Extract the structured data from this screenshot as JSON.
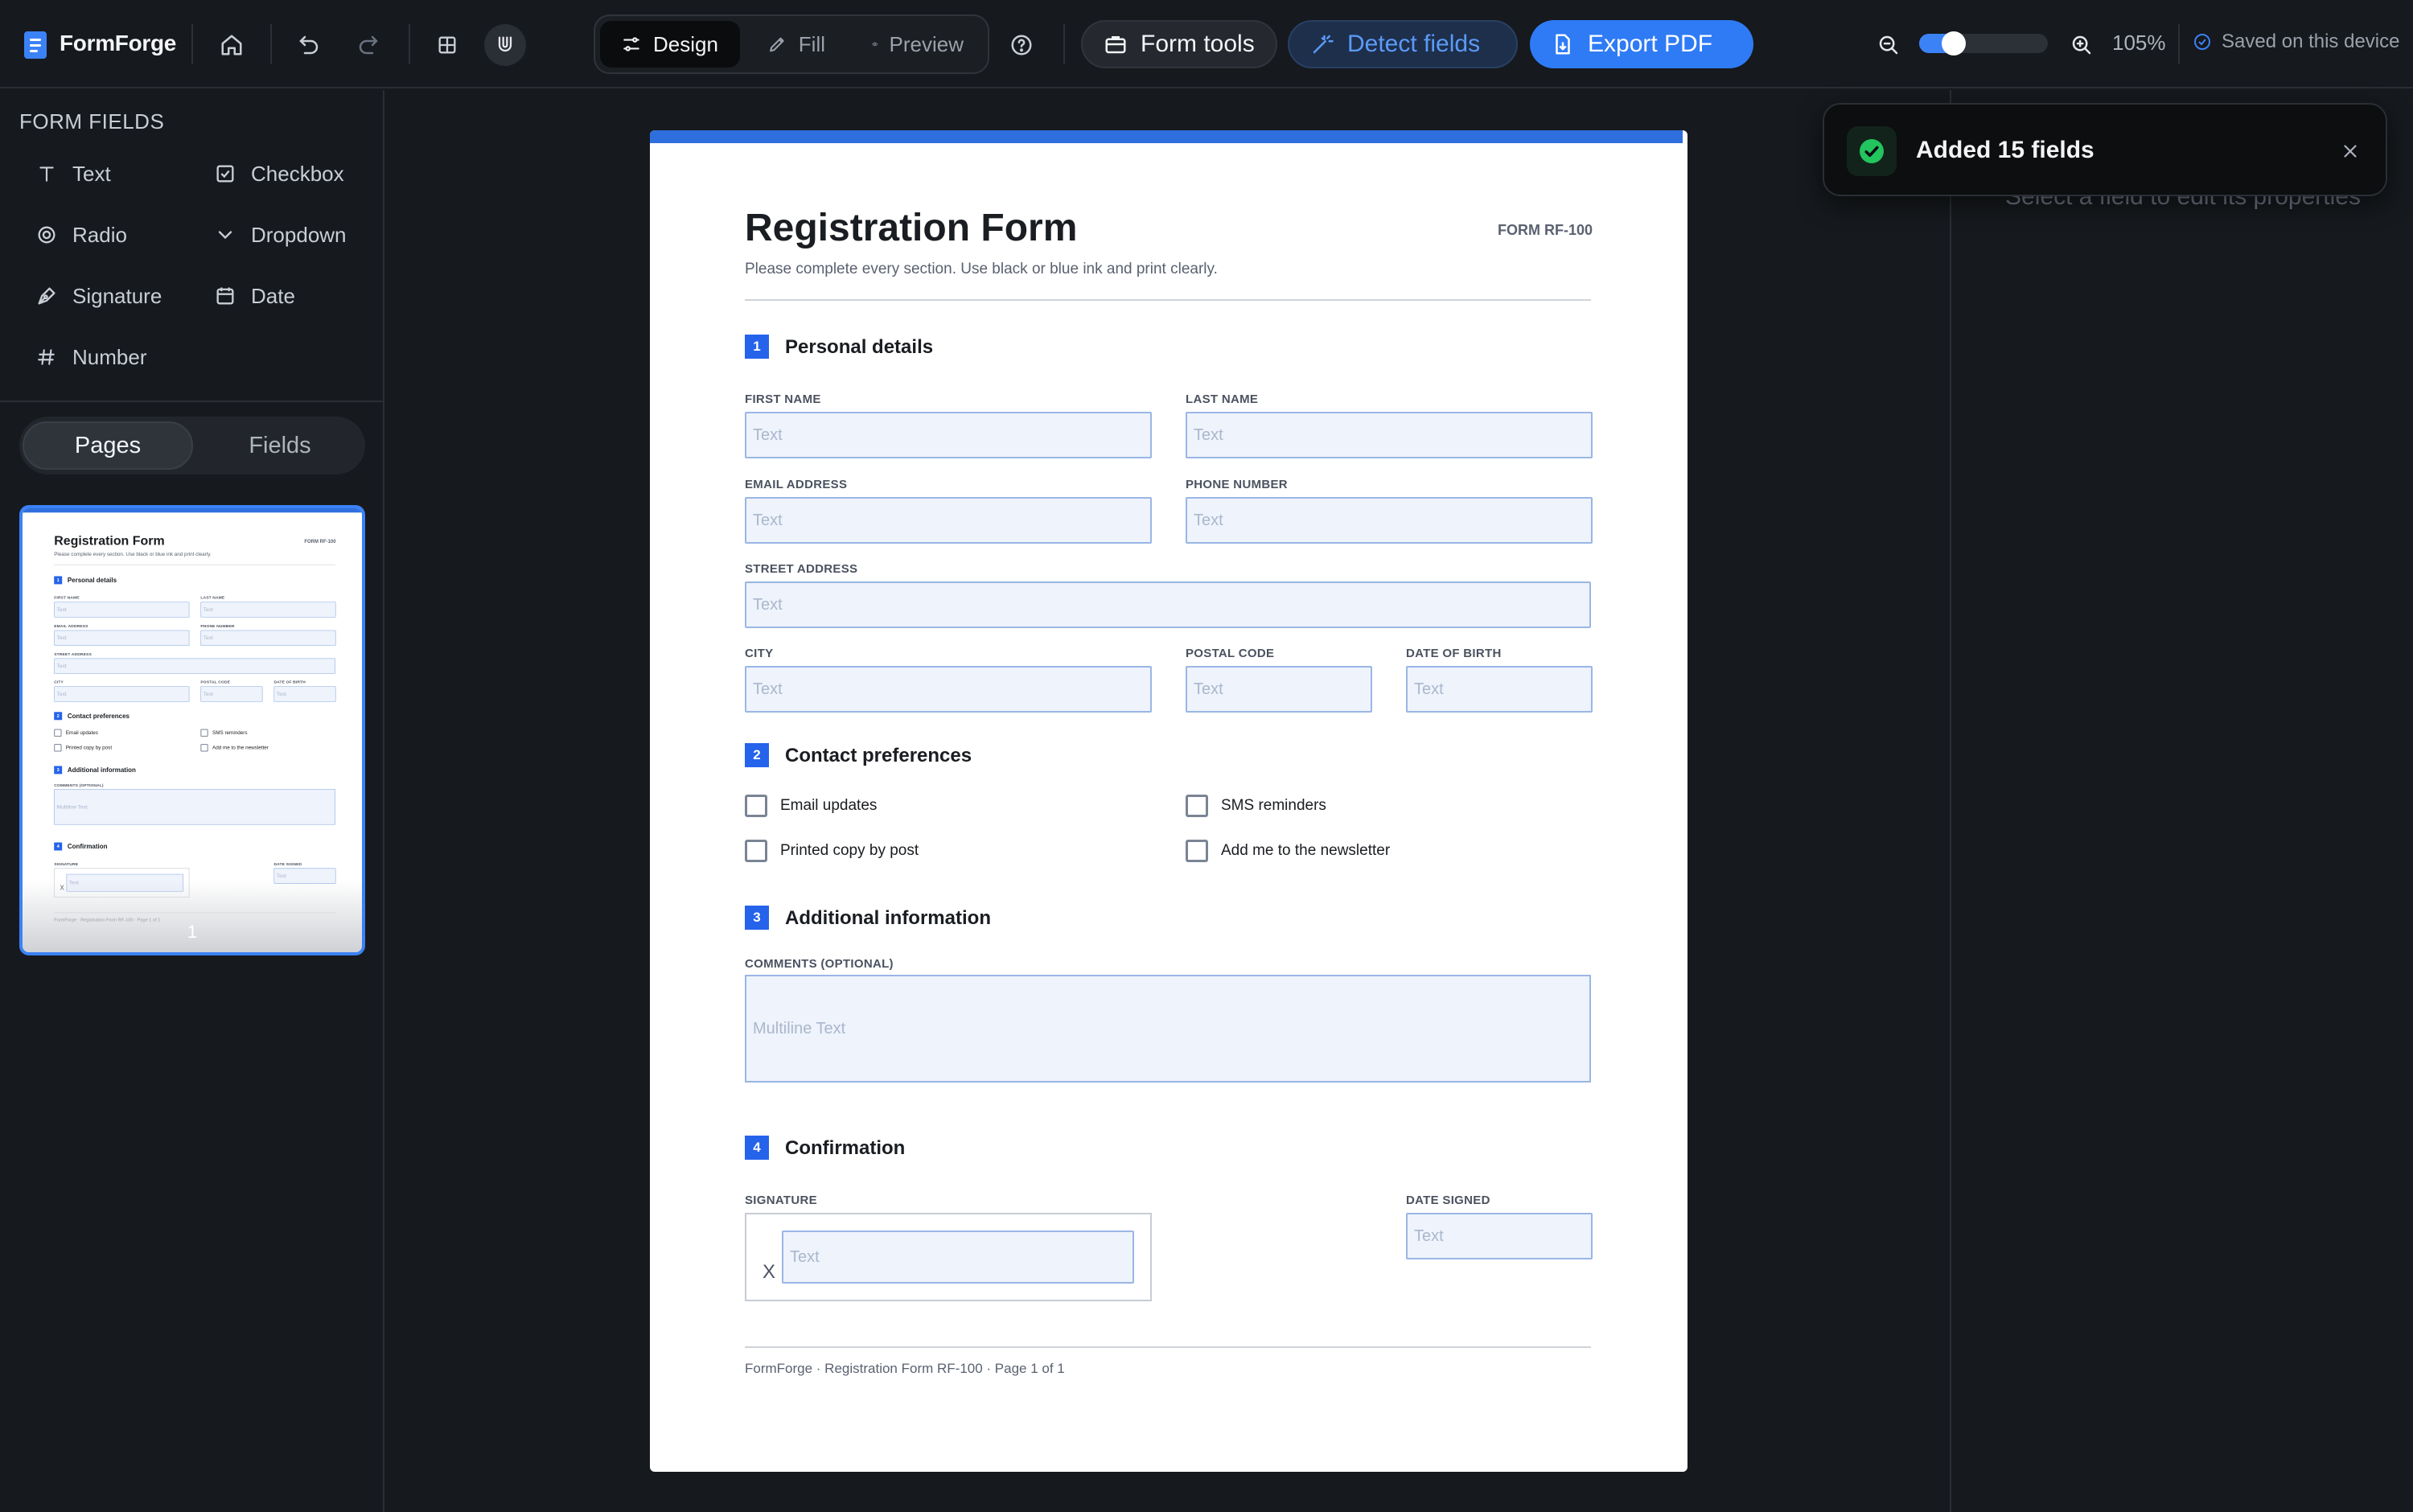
{
  "app": {
    "name": "FormForge"
  },
  "toolbar": {
    "modes": [
      {
        "label": "Design",
        "icon": "sliders-icon",
        "active": true
      },
      {
        "label": "Fill",
        "icon": "pen-icon",
        "active": false
      },
      {
        "label": "Preview",
        "icon": "eye-icon",
        "active": false
      }
    ],
    "form_tools_label": "Form tools",
    "detect_fields_label": "Detect fields",
    "export_pdf_label": "Export PDF",
    "zoom_label": "105%",
    "zoom_slider_level": 0.2,
    "saved_status": "Saved on this device",
    "accent_color": "#2f7bf5"
  },
  "sidebar": {
    "form_fields_title": "FORM FIELDS",
    "field_types": [
      {
        "label": "Text",
        "icon": "text-icon"
      },
      {
        "label": "Checkbox",
        "icon": "checkbox-icon"
      },
      {
        "label": "Radio",
        "icon": "radio-icon"
      },
      {
        "label": "Dropdown",
        "icon": "dropdown-icon"
      },
      {
        "label": "Signature",
        "icon": "signature-icon"
      },
      {
        "label": "Date",
        "icon": "calendar-icon"
      },
      {
        "label": "Number",
        "icon": "hash-icon"
      }
    ],
    "tabs": [
      {
        "label": "Pages",
        "active": true
      },
      {
        "label": "Fields",
        "active": false
      }
    ],
    "page_thumbnail_number": "1"
  },
  "right_panel": {
    "hint": "Select a field to edit its properties"
  },
  "toast": {
    "message": "Added 15 fields",
    "status_color": "#22c55e"
  },
  "document": {
    "title": "Registration Form",
    "form_id": "FORM RF-100",
    "subtitle": "Please complete every section. Use black or blue ink and print clearly.",
    "sections": [
      {
        "number": "1",
        "title": "Personal details"
      },
      {
        "number": "2",
        "title": "Contact preferences"
      },
      {
        "number": "3",
        "title": "Additional information"
      },
      {
        "number": "4",
        "title": "Confirmation"
      }
    ],
    "labels": {
      "first_name": "FIRST NAME",
      "last_name": "LAST NAME",
      "email": "EMAIL ADDRESS",
      "phone": "PHONE NUMBER",
      "street": "STREET ADDRESS",
      "city": "CITY",
      "postal": "POSTAL CODE",
      "dob": "DATE OF BIRTH",
      "comments": "COMMENTS (OPTIONAL)",
      "signature": "SIGNATURE",
      "date_signed": "DATE SIGNED"
    },
    "field_placeholder": "Text",
    "multiline_placeholder": "Multiline Text",
    "checkboxes": [
      "Email updates",
      "SMS reminders",
      "Printed copy by post",
      "Add me to the newsletter"
    ],
    "signature_mark": "X",
    "footer": "FormForge · Registration Form RF-100 · Page 1 of 1"
  }
}
